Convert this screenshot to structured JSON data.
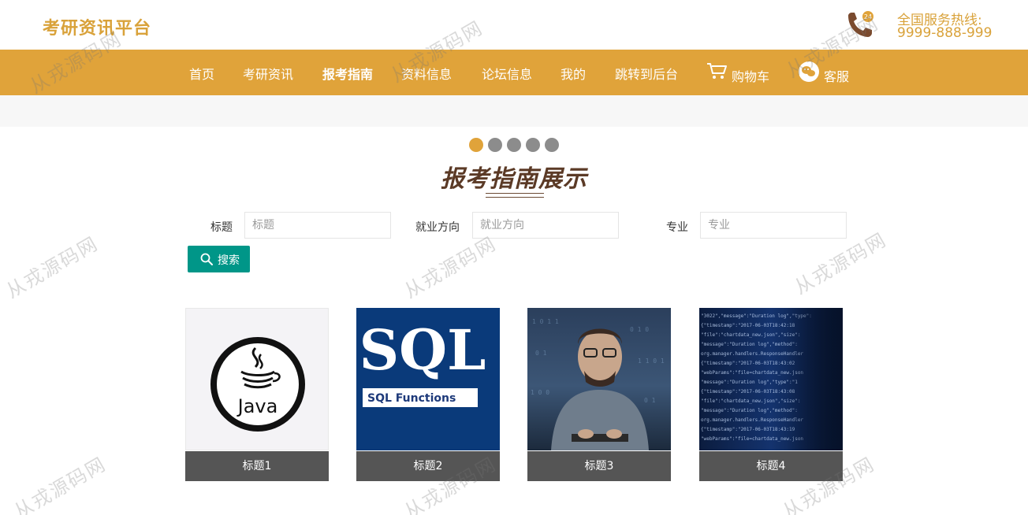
{
  "brand": {
    "title": "考研资讯平台"
  },
  "hotline": {
    "label": "全国服务热线:",
    "number": "9999-888-999"
  },
  "nav": {
    "items": [
      {
        "label": "首页"
      },
      {
        "label": "考研资讯"
      },
      {
        "label": "报考指南",
        "active": true
      },
      {
        "label": "资料信息"
      },
      {
        "label": "论坛信息"
      },
      {
        "label": "我的"
      },
      {
        "label": "跳转到后台"
      },
      {
        "label": "购物车",
        "icon": "cart-icon"
      },
      {
        "label": "客服",
        "icon": "chat-icon"
      }
    ]
  },
  "carousel": {
    "count": 5,
    "active_index": 0
  },
  "section": {
    "title": "报考指南展示"
  },
  "search": {
    "fields": [
      {
        "label": "标题",
        "placeholder": "标题"
      },
      {
        "label": "就业方向",
        "placeholder": "就业方向"
      },
      {
        "label": "专业",
        "placeholder": "专业"
      }
    ],
    "button_label": "搜索",
    "button_icon": "search-icon"
  },
  "cards": [
    {
      "caption": "标题1",
      "image": "java-logo"
    },
    {
      "caption": "标题2",
      "image": "sql-functions"
    },
    {
      "caption": "标题3",
      "image": "programmer-photo"
    },
    {
      "caption": "标题4",
      "image": "code-stream"
    }
  ],
  "card_images": {
    "java_text": "Java",
    "sql_title": "SQL",
    "sql_subtitle": "SQL Functions"
  },
  "watermark": {
    "text": "从戎源码网"
  },
  "colors": {
    "accent": "#e0a33a",
    "brand_text": "#d9a23a",
    "title": "#5b3a26",
    "search_button": "#009688",
    "caption_bg": "#555555",
    "dot_inactive": "#8c8c8c"
  }
}
